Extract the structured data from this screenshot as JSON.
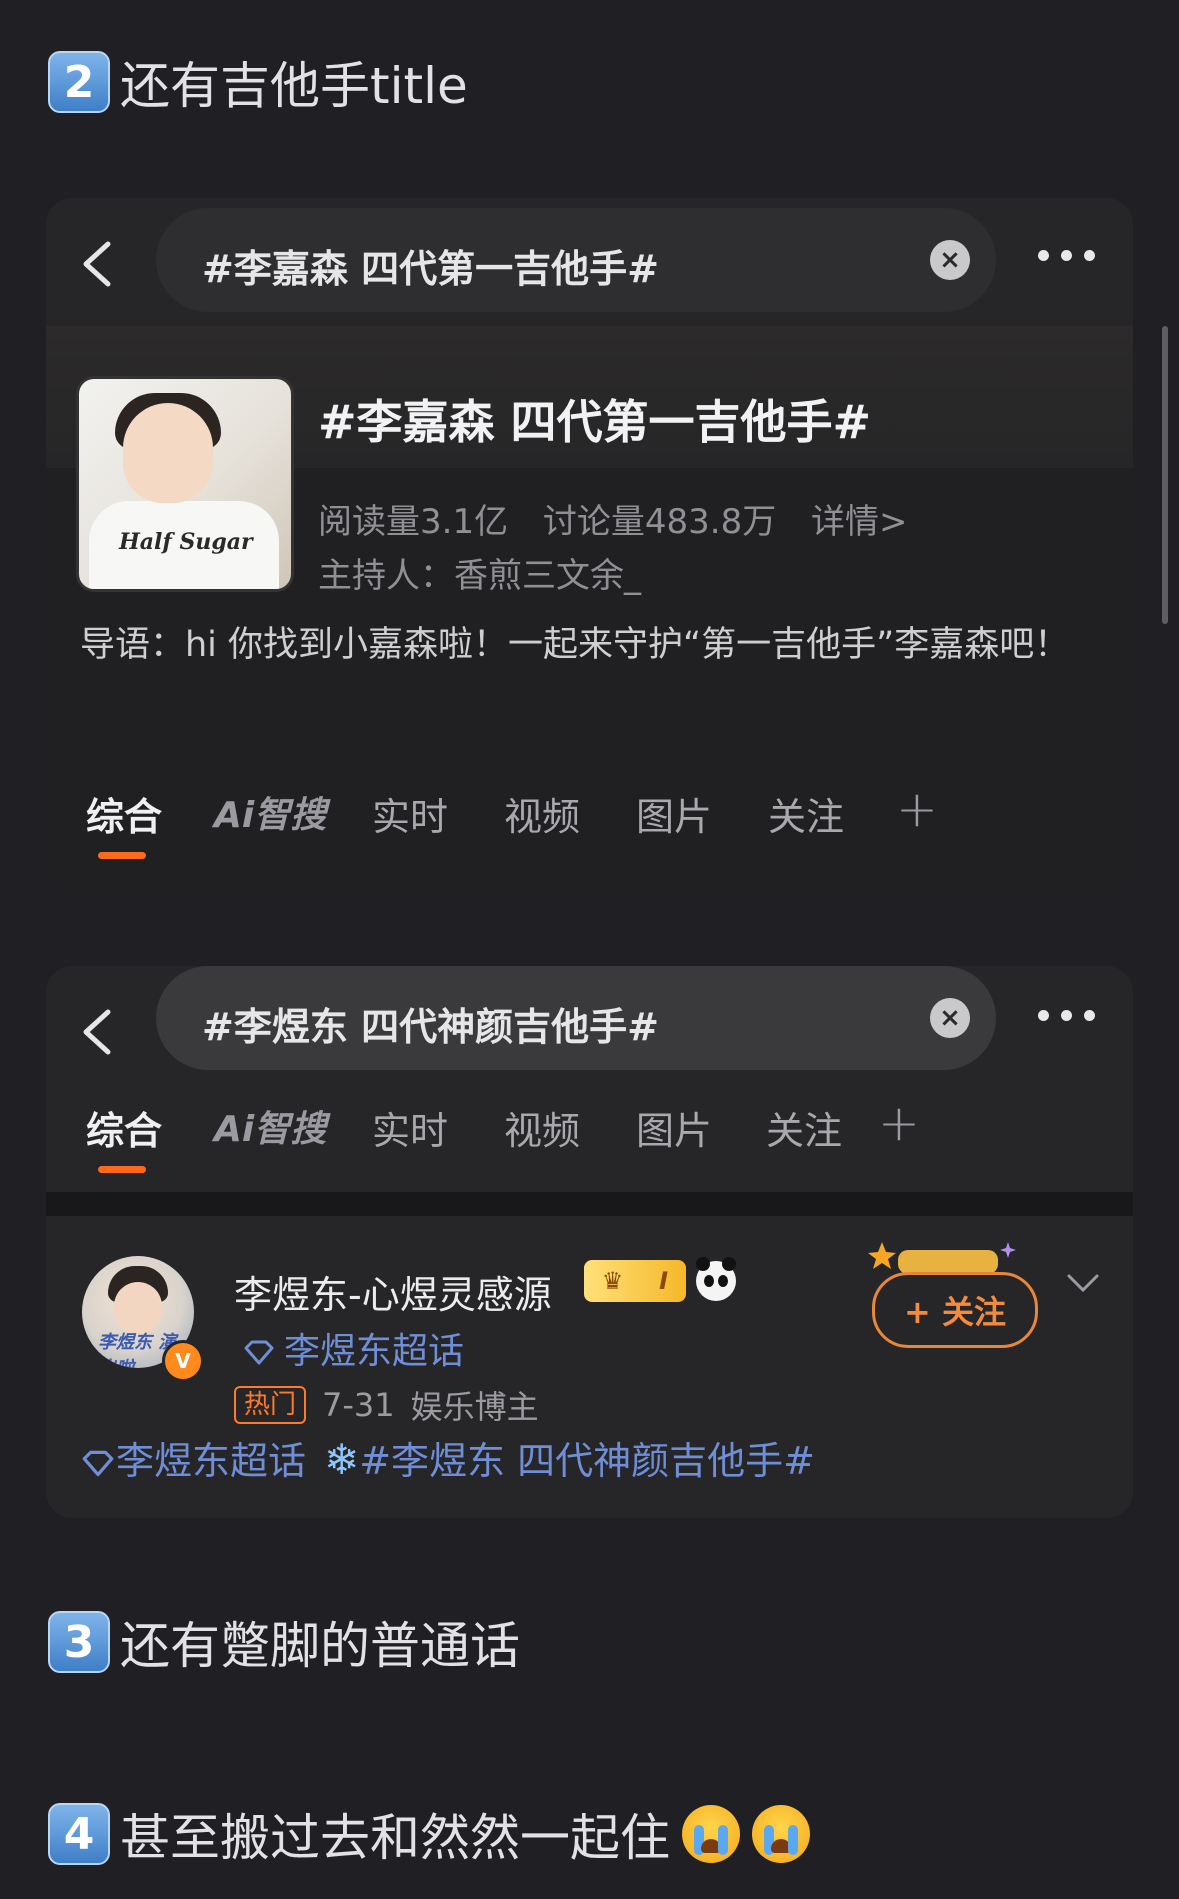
{
  "headings": {
    "h2": {
      "num": "2",
      "text": "还有吉他手title"
    },
    "h3": {
      "num": "3",
      "text": "还有蹩脚的普通话"
    },
    "h4": {
      "num": "4",
      "text": "甚至搬过去和然然一起住"
    }
  },
  "card1": {
    "search_text": "#李嘉森 四代第一吉他手#",
    "clear_icon": "×",
    "topic_title": "#李嘉森 四代第一吉他手#",
    "reads": "阅读量3.1亿",
    "discussions": "讨论量483.8万",
    "details": "详情>",
    "host": "主持人：香煎三文余_",
    "avatar_print": "Half Sugar",
    "intro": "导语：hi 你找到小嘉森啦！一起来守护“第一吉他手”李嘉森吧！"
  },
  "tabs": [
    "综合",
    "Ai智搜",
    "实时",
    "视频",
    "图片",
    "关注"
  ],
  "tabs_plus": "+",
  "card2": {
    "search_text": "#李煜东 四代神颜吉他手#",
    "clear_icon": "×",
    "username": "李煜东-心煜灵感源",
    "level_badge": "I",
    "super_topic": "李煜东超话",
    "hot_label": "热门",
    "date": "7-31",
    "role": "娱乐博主",
    "follow_label": "+ 关注",
    "avatar_caption": "李煜东 演出啦",
    "verified_mark": "V",
    "tag_supertopic": "李煜东超话",
    "tag_snow": "❄",
    "tag_topic": "#李煜东 四代神颜吉他手#"
  },
  "colors": {
    "accent_orange": "#ff6a1a",
    "link_blue": "#6f8ed6",
    "background": "#1f1f24"
  }
}
